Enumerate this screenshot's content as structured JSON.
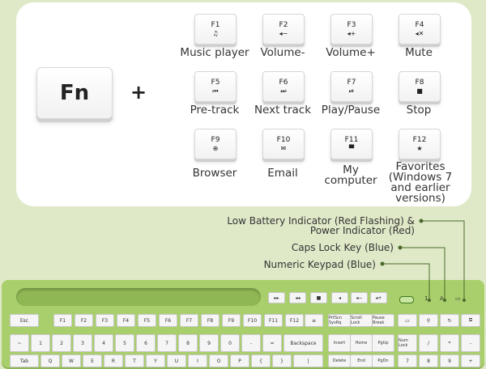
{
  "fn_label": "Fn",
  "plus_sign": "+",
  "fkeys": [
    {
      "key": "F1",
      "glyph": "♫",
      "label": "Music player"
    },
    {
      "key": "F2",
      "glyph": "◂−",
      "label": "Volume-"
    },
    {
      "key": "F3",
      "glyph": "◂+",
      "label": "Volume+"
    },
    {
      "key": "F4",
      "glyph": "◂✕",
      "label": "Mute"
    },
    {
      "key": "F5",
      "glyph": "⏮",
      "label": "Pre-track"
    },
    {
      "key": "F6",
      "glyph": "⏭",
      "label": "Next track"
    },
    {
      "key": "F7",
      "glyph": "⏯",
      "label": "Play/Pause"
    },
    {
      "key": "F8",
      "glyph": "■",
      "label": "Stop"
    },
    {
      "key": "F9",
      "glyph": "⊕",
      "label": "Browser"
    },
    {
      "key": "F10",
      "glyph": "✉",
      "label": "Email"
    },
    {
      "key": "F11",
      "glyph": "▀",
      "label": "My computer"
    },
    {
      "key": "F12",
      "glyph": "★",
      "label": "Favorites (Windows 7 and earlier versions)"
    }
  ],
  "callouts": {
    "battery": "Low Battery Indicator (Red Flashing) & Power Indicator (Red)",
    "caps": "Caps Lock Key (Blue)",
    "numeric": "Numeric Keypad (Blue)"
  },
  "keyboard": {
    "esc": "Esc",
    "backspace": "Backspace",
    "tab": "Tab",
    "fn_row": [
      "F1",
      "F2",
      "F3",
      "F4",
      "F5",
      "F6",
      "F7",
      "F8",
      "F9",
      "F10",
      "F11",
      "F12"
    ],
    "num_row": [
      "~",
      "1",
      "2",
      "3",
      "4",
      "5",
      "6",
      "7",
      "8",
      "9",
      "0",
      "-",
      "="
    ],
    "q_row": [
      "Q",
      "W",
      "E",
      "R",
      "T",
      "Y",
      "U",
      "I",
      "O",
      "P",
      "{",
      "}",
      "|"
    ],
    "nav_top": [
      "PrtScn SysRq",
      "Scroll Lock",
      "Pause Break"
    ],
    "nav_mid": [
      "Insert",
      "Home",
      "PgUp"
    ],
    "nav_low": [
      "Delete",
      "End",
      "PgDn"
    ],
    "num_top": [
      "Num Lock",
      "/",
      "*",
      "-"
    ],
    "num_mid": [
      "7",
      "8",
      "9",
      "+"
    ],
    "leds": [
      "1",
      "A"
    ]
  }
}
